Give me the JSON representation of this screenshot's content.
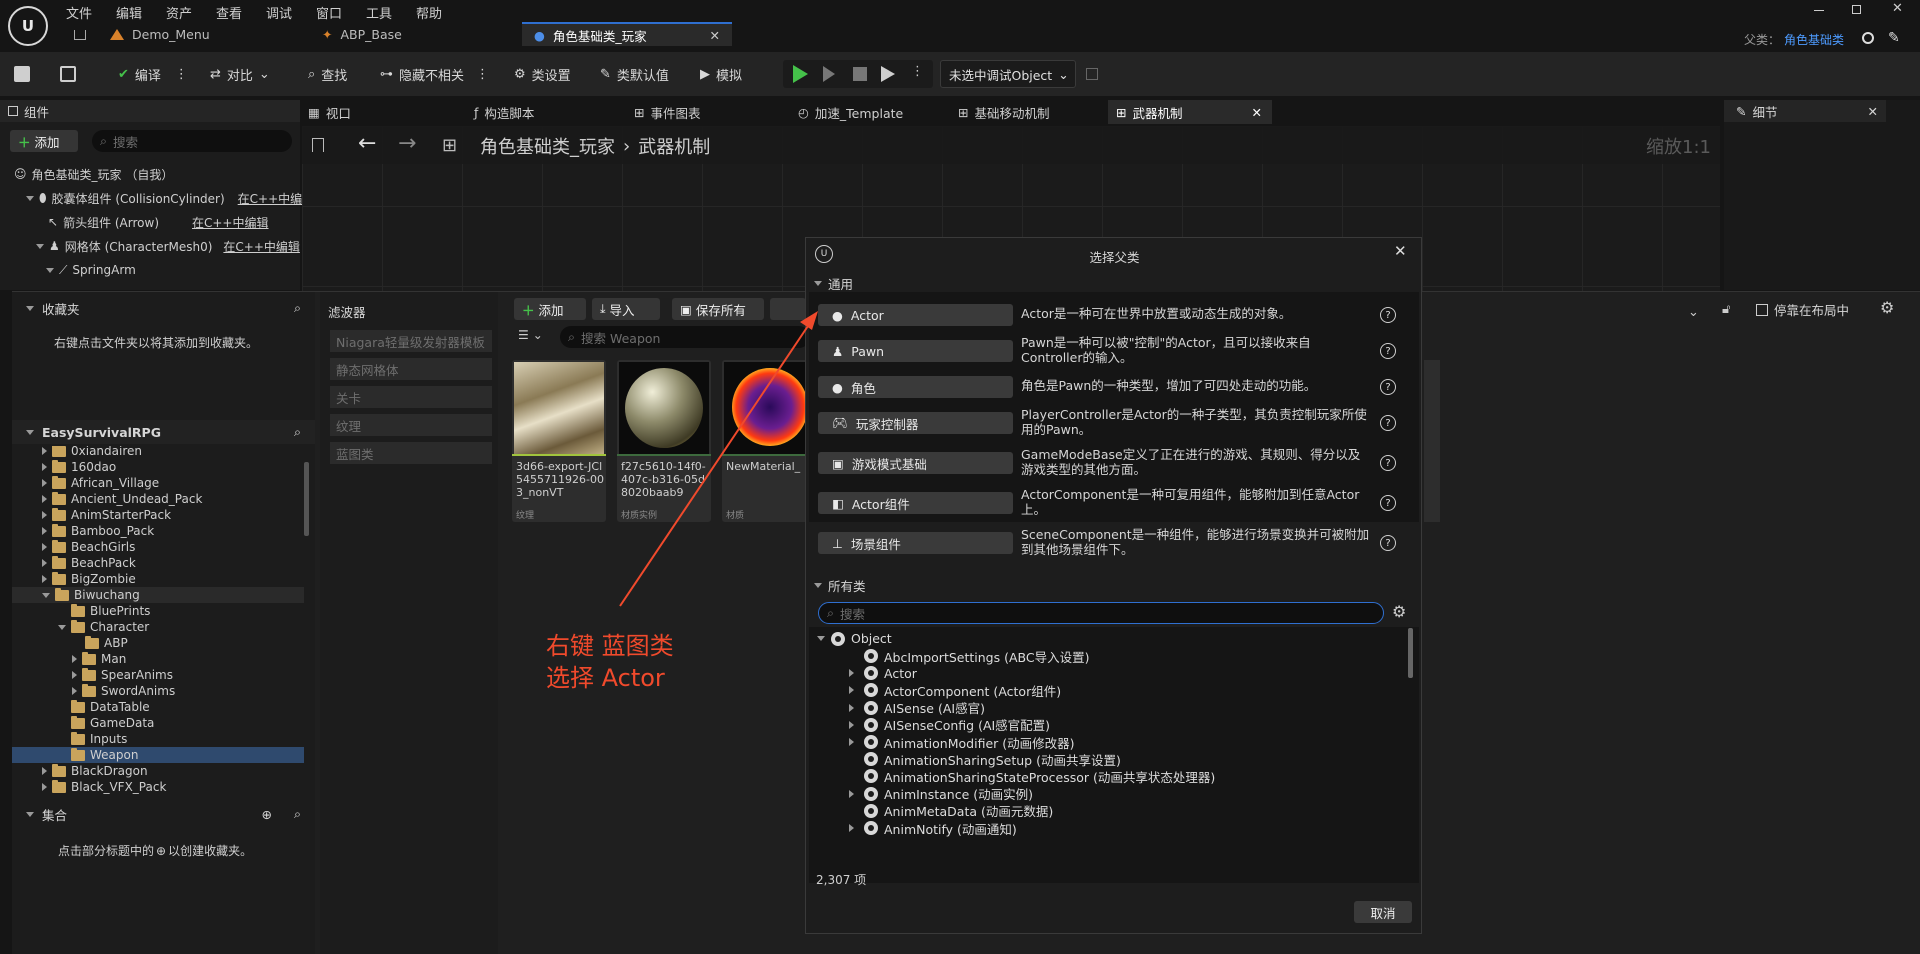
{
  "menu": [
    "文件",
    "编辑",
    "资产",
    "查看",
    "调试",
    "窗口",
    "工具",
    "帮助"
  ],
  "doc_tabs": [
    {
      "label": "Demo_Menu",
      "active": false
    },
    {
      "label": "ABP_Base",
      "active": false
    },
    {
      "label": "角色基础类_玩家",
      "active": true
    }
  ],
  "parent_class": {
    "label": "父类：",
    "value": "角色基础类"
  },
  "toolbar": {
    "compile": "编译",
    "diff": "对比",
    "find": "查找",
    "hide_unrelated": "隐藏不相关",
    "class_settings": "类设置",
    "class_defaults": "类默认值",
    "simulate": "模拟",
    "debug_object": "未选中调试Object"
  },
  "components_panel": {
    "title": "组件",
    "add": "添加",
    "search_placeholder": "搜索",
    "items": [
      {
        "label": "角色基础类_玩家 （自我）",
        "edit": ""
      },
      {
        "label": "胶囊体组件 (CollisionCylinder)",
        "edit": "在C++中编"
      },
      {
        "label": "箭头组件 (Arrow)",
        "edit": "在C++中编辑"
      },
      {
        "label": "网格体 (CharacterMesh0)",
        "edit": "在C++中编辑"
      },
      {
        "label": "SpringArm",
        "edit": ""
      }
    ]
  },
  "editor_tabs": [
    {
      "label": "视口"
    },
    {
      "label": "构造脚本"
    },
    {
      "label": "事件图表"
    },
    {
      "label": "加速_Template"
    },
    {
      "label": "基础移动机制"
    },
    {
      "label": "武器机制",
      "active": true
    }
  ],
  "graph": {
    "breadcrumb_root": "角色基础类_玩家",
    "breadcrumb_current": "武器机制",
    "zoom": "缩放1:1"
  },
  "details": {
    "title": "细节"
  },
  "content_browser": {
    "favorites_title": "收藏夹",
    "favorites_hint": "右键点击文件夹以将其添加到收藏夹。",
    "root": "EasySurvivalRPG",
    "folders": [
      {
        "label": "0xiandairen",
        "depth": 0
      },
      {
        "label": "160dao",
        "depth": 0
      },
      {
        "label": "African_Village",
        "depth": 0
      },
      {
        "label": "Ancient_Undead_Pack",
        "depth": 0
      },
      {
        "label": "AnimStarterPack",
        "depth": 0
      },
      {
        "label": "Bamboo_Pack",
        "depth": 0
      },
      {
        "label": "BeachGirls",
        "depth": 0
      },
      {
        "label": "BeachPack",
        "depth": 0
      },
      {
        "label": "BigZombie",
        "depth": 0
      },
      {
        "label": "Biwuchang",
        "depth": 0,
        "open": true
      },
      {
        "label": "BluePrints",
        "depth": 1
      },
      {
        "label": "Character",
        "depth": 1,
        "open": true
      },
      {
        "label": "ABP",
        "depth": 2
      },
      {
        "label": "Man",
        "depth": 2
      },
      {
        "label": "SpearAnims",
        "depth": 2
      },
      {
        "label": "SwordAnims",
        "depth": 2
      },
      {
        "label": "DataTable",
        "depth": 1
      },
      {
        "label": "GameData",
        "depth": 1
      },
      {
        "label": "Inputs",
        "depth": 1
      },
      {
        "label": "Weapon",
        "depth": 1,
        "selected": true
      },
      {
        "label": "BlackDragon",
        "depth": 0
      },
      {
        "label": "Black_VFX_Pack",
        "depth": 0
      }
    ],
    "collections_title": "集合",
    "collections_hint_a": "点击部分标题中的",
    "collections_hint_b": "以创建收藏夹。",
    "filters_title": "滤波器",
    "filters": [
      "Niagara轻量级发射器模板",
      "静态网格体",
      "关卡",
      "纹理",
      "蓝图类"
    ],
    "add": "添加",
    "import": "导入",
    "save_all": "保存所有",
    "search_placeholder": "搜索 Weapon",
    "dock_label": "停靠在布局中",
    "assets": [
      {
        "name": "3d66-export-JCl5455711926-003_nonVT",
        "type": "纹理"
      },
      {
        "name": "f27c5610-14f0-407c-b316-05d8020baab9",
        "type": "材质实例"
      },
      {
        "name": "NewMaterial_",
        "type": "材质"
      }
    ]
  },
  "annotation": {
    "line1": "右键 蓝图类",
    "line2": "选择 Actor",
    "color": "#f04a2c"
  },
  "dialog": {
    "title": "选择父类",
    "common_header": "通用",
    "common": [
      {
        "label": "Actor",
        "desc": "Actor是一种可在世界中放置或动态生成的对象。"
      },
      {
        "label": "Pawn",
        "desc": "Pawn是一种可以被\"控制\"的Actor，且可以接收来自Controller的输入。"
      },
      {
        "label": "角色",
        "desc": "角色是Pawn的一种类型，增加了可四处走动的功能。"
      },
      {
        "label": "玩家控制器",
        "desc": "PlayerController是Actor的一种子类型，其负责控制玩家所使用的Pawn。"
      },
      {
        "label": "游戏模式基础",
        "desc": "GameModeBase定义了正在进行的游戏、其规则、得分以及游戏类型的其他方面。"
      },
      {
        "label": "Actor组件",
        "desc": "ActorComponent是一种可复用组件，能够附加到任意Actor上。"
      },
      {
        "label": "场景组件",
        "desc": "SceneComponent是一种组件，能够进行场景变换并可被附加到其他场景组件下。"
      }
    ],
    "all_header": "所有类",
    "search_placeholder": "搜索",
    "root": "Object",
    "classes": [
      "AbcImportSettings (ABC导入设置)",
      "Actor",
      "ActorComponent (Actor组件)",
      "AISense (AI感官)",
      "AISenseConfig (AI感官配置)",
      "AnimationModifier (动画修改器)",
      "AnimationSharingSetup (动画共享设置)",
      "AnimationSharingStateProcessor (动画共享状态处理器)",
      "AnimInstance (动画实例)",
      "AnimMetaData (动画元数据)",
      "AnimNotify (动画通知)"
    ],
    "count": "2,307 项",
    "cancel": "取消"
  }
}
